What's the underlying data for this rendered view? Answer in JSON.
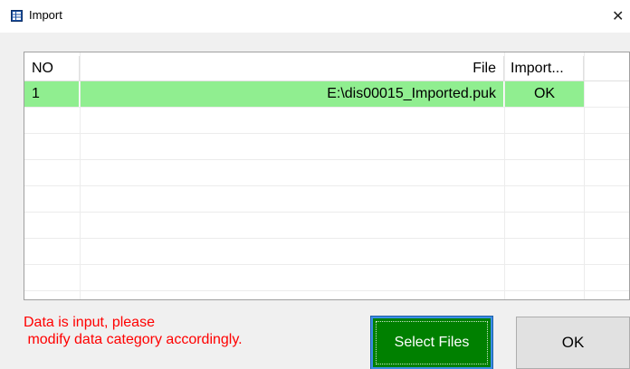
{
  "window": {
    "title": "Import",
    "close_glyph": "✕"
  },
  "table": {
    "columns": [
      "NO",
      "File",
      "Import..."
    ],
    "rows": [
      {
        "no": "1",
        "file": "E:\\dis00015_Imported.puk",
        "status": "OK"
      }
    ]
  },
  "message": {
    "text": "Data is input, please\n modify data category accordingly.",
    "color": "#ff0000"
  },
  "buttons": {
    "select_files": "Select Files",
    "ok": "OK"
  },
  "colors": {
    "selected_row": "#90ee90",
    "select_button": "#008000",
    "focus_border": "#3c8ee6"
  }
}
